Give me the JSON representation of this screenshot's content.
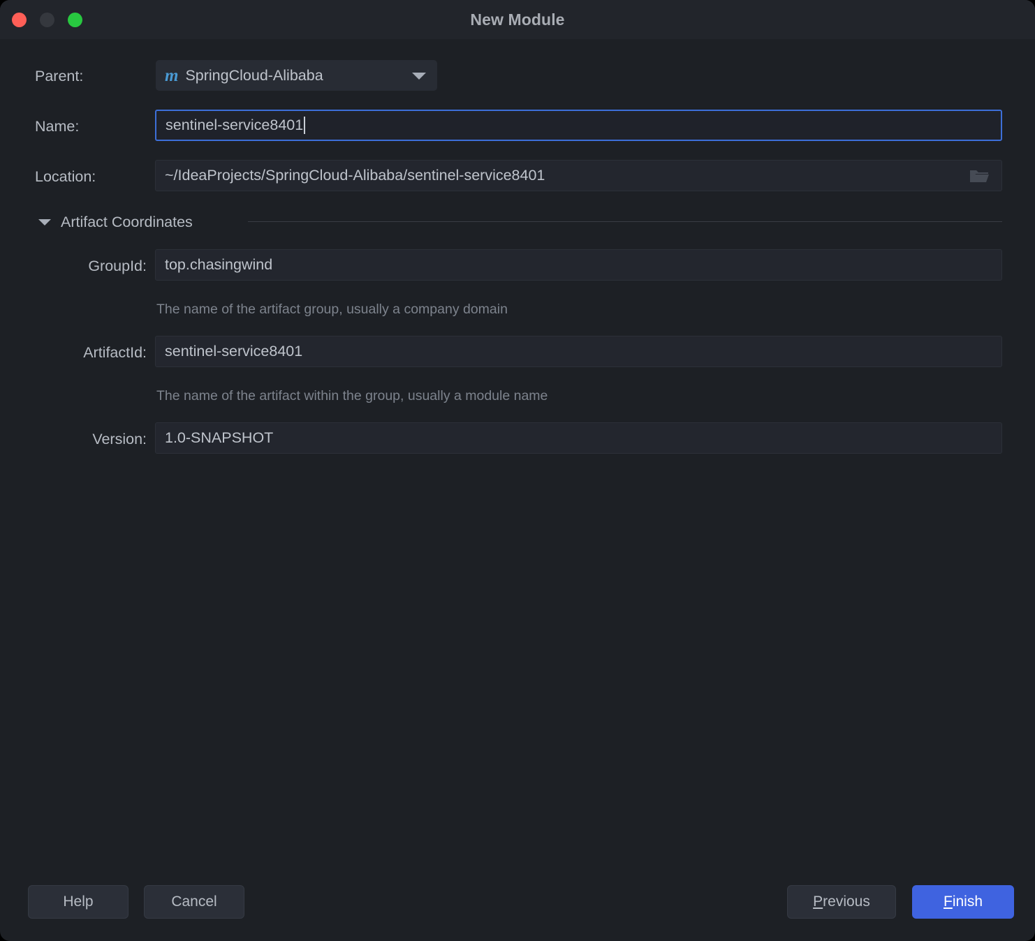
{
  "window": {
    "title": "New Module",
    "traffic_lights": [
      "close-button",
      "minimize-button",
      "maximize-button"
    ]
  },
  "form": {
    "parent": {
      "label": "Parent:",
      "icon": "maven-module-icon",
      "icon_glyph": "m",
      "value": "SpringCloud-Alibaba",
      "dropdown_icon": "chevron-down-icon"
    },
    "name": {
      "label": "Name:",
      "value": "sentinel-service8401",
      "focused": true
    },
    "location": {
      "label": "Location:",
      "value": "~/IdeaProjects/SpringCloud-Alibaba/sentinel-service8401",
      "browse_icon": "folder-icon"
    }
  },
  "artifact_section": {
    "label": "Artifact Coordinates",
    "expanded": true,
    "toggle_icon": "triangle-down-icon",
    "fields": {
      "group_id": {
        "label": "GroupId:",
        "value": "top.chasingwind",
        "hint": "The name of the artifact group, usually a company domain"
      },
      "artifact_id": {
        "label": "ArtifactId:",
        "value": "sentinel-service8401",
        "hint": "The name of the artifact within the group, usually a module name"
      },
      "version": {
        "label": "Version:",
        "value": "1.0-SNAPSHOT"
      }
    }
  },
  "footer": {
    "help": "Help",
    "cancel": "Cancel",
    "previous_prefix": "P",
    "previous_rest": "revious",
    "finish_prefix": "F",
    "finish_rest": "inish"
  },
  "colors": {
    "dialog_bg": "#1d2025",
    "titlebar_bg": "#22252b",
    "field_bg": "#23262e",
    "focus_blue": "#3d6fd8",
    "primary_blue": "#3f63e0",
    "maven_blue": "#4a9ad4",
    "text": "#b7bcc4",
    "hint_text": "#7d838d",
    "close_red": "#ff5f57",
    "minimize_gray": "#35383e",
    "maximize_green": "#28c840"
  }
}
